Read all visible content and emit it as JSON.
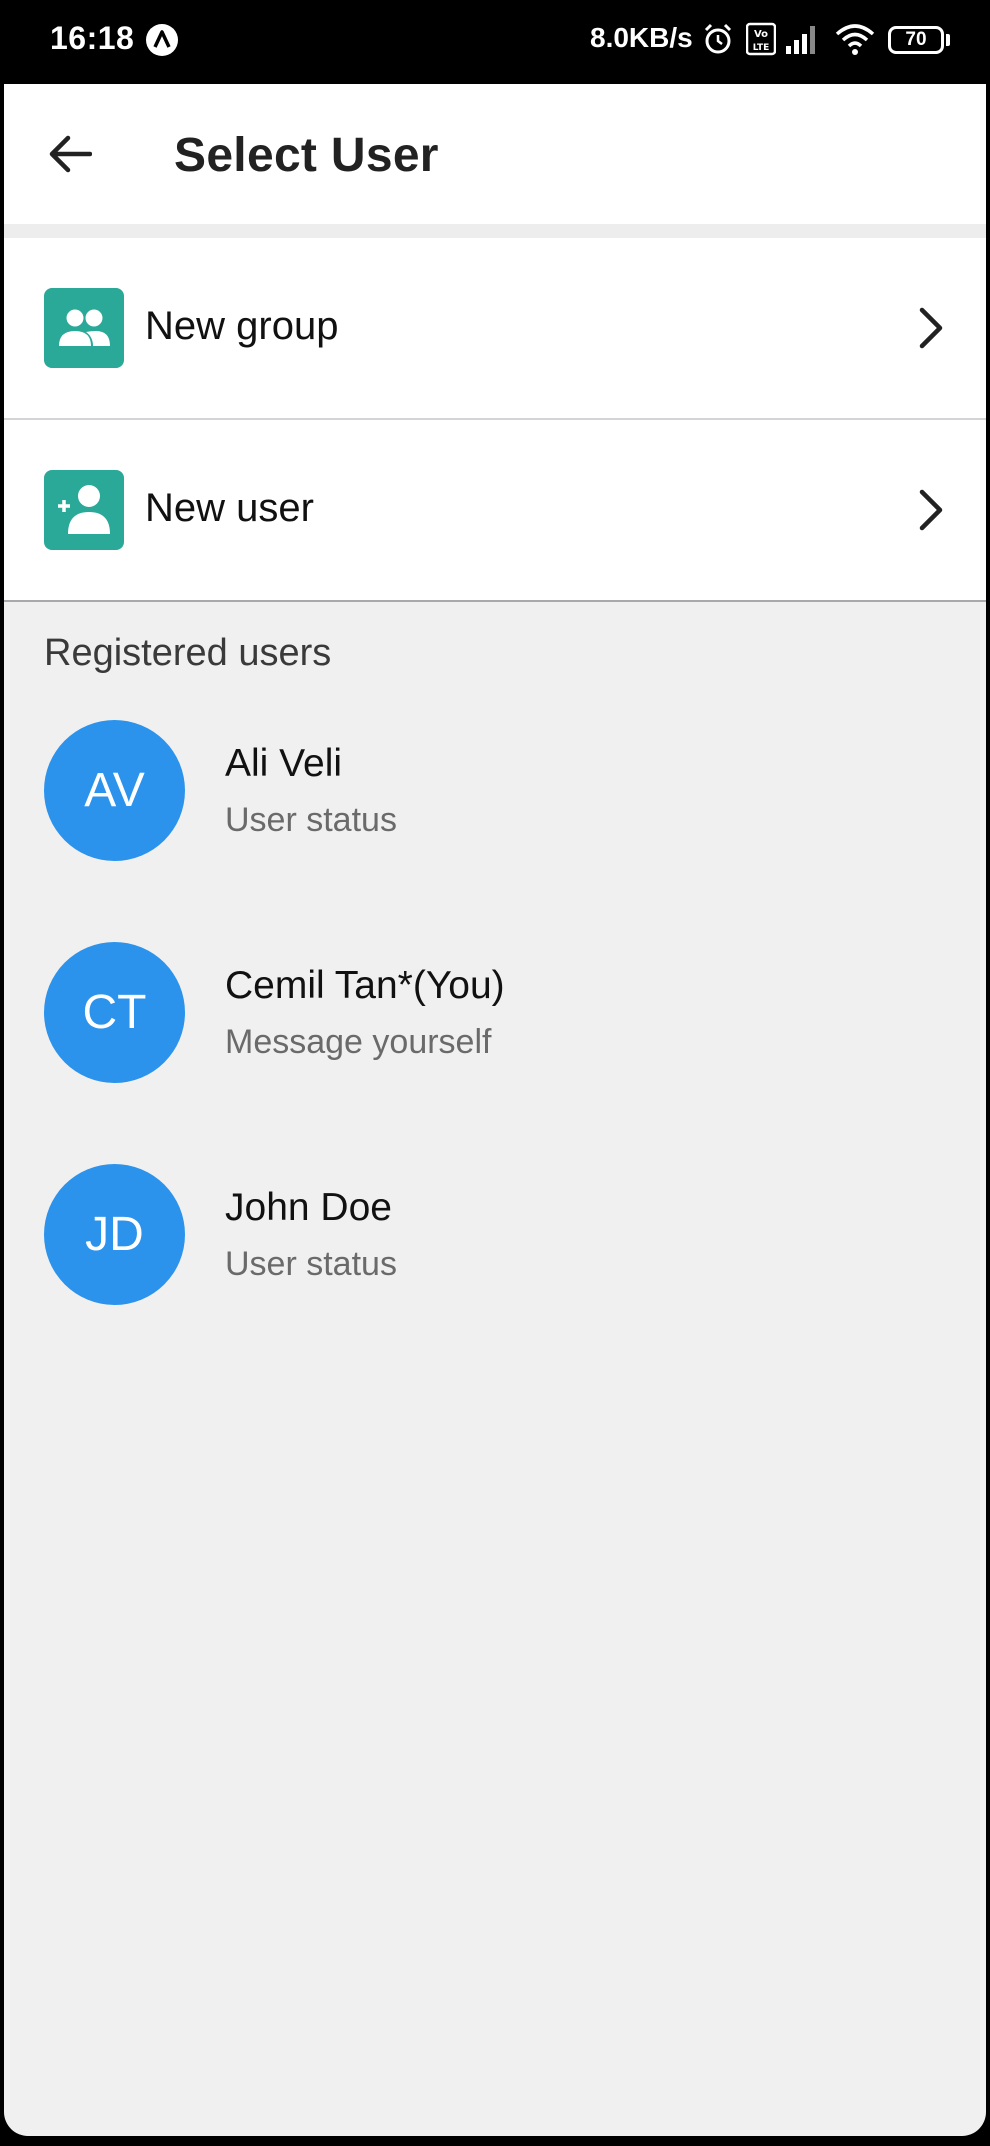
{
  "status_bar": {
    "time": "16:18",
    "app_icon": "a-app-icon",
    "network_speed": "8.0KB/s",
    "icons": [
      "alarm-icon",
      "volte-icon",
      "signal-icon",
      "wifi-icon"
    ],
    "battery_level": "70"
  },
  "app_bar": {
    "back_icon": "arrow-left-icon",
    "title": "Select User"
  },
  "actions": [
    {
      "label": "New group",
      "icon": "group-icon",
      "chevron": "chevron-right-icon"
    },
    {
      "label": "New user",
      "icon": "add-user-icon",
      "chevron": "chevron-right-icon"
    }
  ],
  "registered": {
    "section_title": "Registered users",
    "users": [
      {
        "initials": "AV",
        "name": "Ali Veli",
        "status": "User status"
      },
      {
        "initials": "CT",
        "name": "Cemil Tan*(You)",
        "status": "Message yourself"
      },
      {
        "initials": "JD",
        "name": "John Doe",
        "status": "User status"
      }
    ]
  },
  "colors": {
    "accent_teal": "#2aa898",
    "avatar_blue": "#2b93ec",
    "background": "#f0f0f1"
  }
}
